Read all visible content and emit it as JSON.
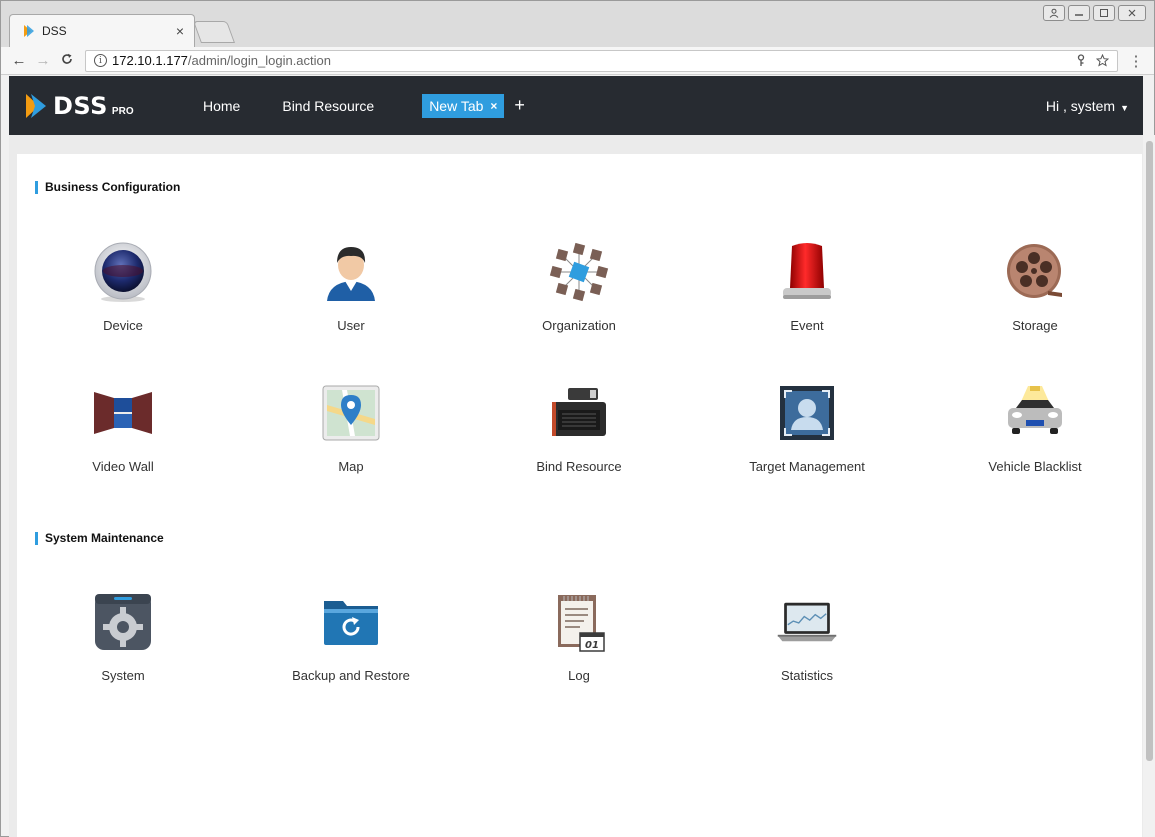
{
  "browser": {
    "tab_title": "DSS",
    "tab_close": "×",
    "url_host": "172.10.1.177",
    "url_path": "/admin/login_login.action"
  },
  "header": {
    "logo_text": "DSS",
    "logo_sup": "PRO",
    "nav": [
      "Home",
      "Bind Resource"
    ],
    "active_tab": "New Tab",
    "active_tab_close": "×",
    "add_tab": "+",
    "user_greeting": "Hi , system"
  },
  "sections": {
    "business": {
      "title": "Business Configuration",
      "items": [
        {
          "label": "Device",
          "icon": "device-camera-icon"
        },
        {
          "label": "User",
          "icon": "user-icon"
        },
        {
          "label": "Organization",
          "icon": "organization-icon"
        },
        {
          "label": "Event",
          "icon": "alarm-light-icon"
        },
        {
          "label": "Storage",
          "icon": "film-reel-icon"
        },
        {
          "label": "Video Wall",
          "icon": "video-wall-icon"
        },
        {
          "label": "Map",
          "icon": "map-pin-icon"
        },
        {
          "label": "Bind Resource",
          "icon": "nvr-device-icon"
        },
        {
          "label": "Target Management",
          "icon": "face-target-icon"
        },
        {
          "label": "Vehicle Blacklist",
          "icon": "car-icon"
        }
      ]
    },
    "maintenance": {
      "title": "System Maintenance",
      "items": [
        {
          "label": "System",
          "icon": "gear-icon"
        },
        {
          "label": "Backup and Restore",
          "icon": "backup-folder-icon"
        },
        {
          "label": "Log",
          "icon": "log-notepad-icon"
        },
        {
          "label": "Statistics",
          "icon": "statistics-laptop-icon"
        }
      ]
    }
  },
  "colors": {
    "header_bg": "#272b31",
    "accent": "#2f9ddf"
  }
}
